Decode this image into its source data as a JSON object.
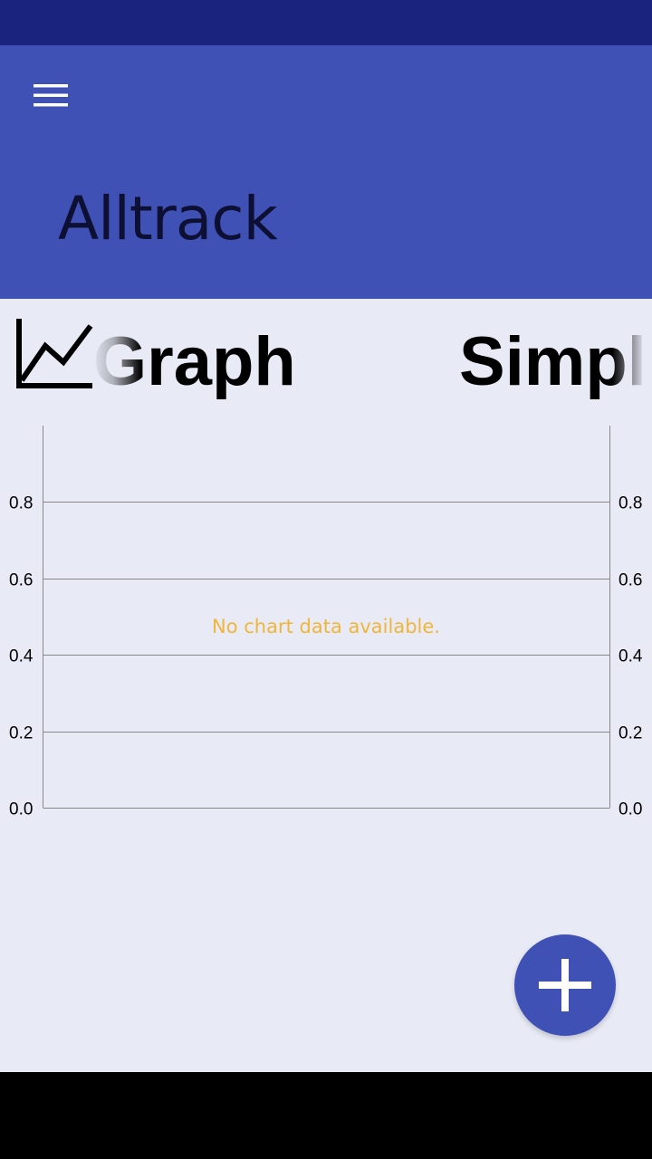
{
  "app": {
    "title": "Alltrack"
  },
  "icons": {
    "menu": "hamburger-menu-icon",
    "graph": "line-chart-icon",
    "add": "plus-icon"
  },
  "tabs": [
    {
      "label": "Graph"
    },
    {
      "label": "Simpl"
    }
  ],
  "chart": {
    "empty_message": "No chart data available.",
    "left_axis_ticks": [
      "0.8",
      "0.6",
      "0.4",
      "0.2",
      "0.0"
    ],
    "right_axis_ticks": [
      "0.8",
      "0.6",
      "0.4",
      "0.2",
      "0.0"
    ]
  },
  "chart_data": {
    "type": "line",
    "series": [],
    "ylim": [
      0,
      1
    ],
    "y_ticks": [
      0.0,
      0.2,
      0.4,
      0.6,
      0.8
    ],
    "grid": true,
    "dual_y_axis": true
  },
  "colors": {
    "status_bar": "#1a237e",
    "primary": "#3f51b5",
    "background": "#e8eaf6",
    "empty_message": "#f0b63a"
  }
}
